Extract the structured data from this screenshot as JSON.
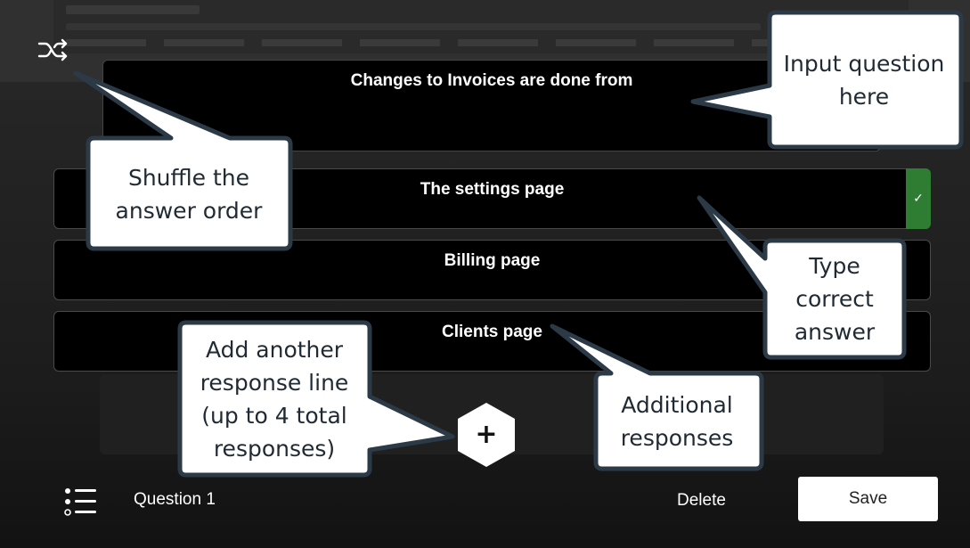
{
  "question": {
    "text": "Changes to Invoices are done from"
  },
  "answers": [
    {
      "text": "The settings page",
      "correct": true
    },
    {
      "text": "Billing page",
      "correct": false
    },
    {
      "text": "Clients page",
      "correct": false
    }
  ],
  "correct_marker": "✓",
  "icons": {
    "shuffle": "shuffle-icon",
    "add": "plus-icon",
    "list": "list-icon",
    "check": "check-icon"
  },
  "add_button_label": "+",
  "footer": {
    "question_label": "Question 1",
    "delete_label": "Delete",
    "save_label": "Save"
  },
  "callouts": {
    "input_question": "Input question here",
    "shuffle": "Shuffle the answer order",
    "type_correct": "Type correct answer",
    "add_response": "Add another response line (up to 4 total responses)",
    "additional": "Additional responses"
  },
  "colors": {
    "correct_green": "#2e7d32",
    "callout_fill": "#ffffff",
    "callout_border": "#2b3a46",
    "background": "#0d0d0d"
  }
}
